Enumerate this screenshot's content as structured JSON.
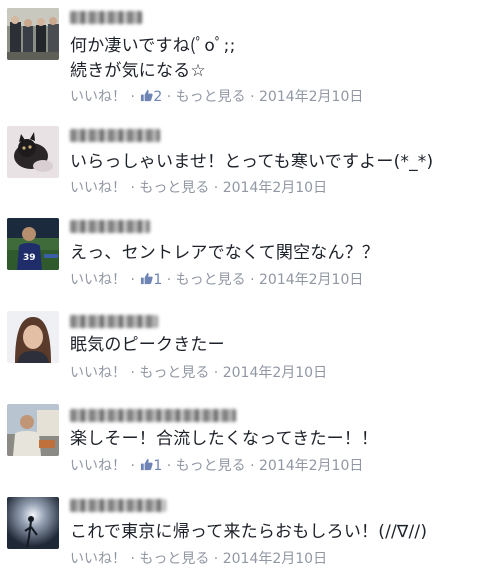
{
  "comments": [
    {
      "text": "何か凄いですね(ﾟoﾟ;;\n続きが気になる☆",
      "actions": {
        "like": "いいね！",
        "like_count": "2",
        "more": "もっと見る",
        "date": "2014年2月10日"
      }
    },
    {
      "text": "いらっしゃいませ！とっても寒いですよー(*_*)",
      "actions": {
        "like": "いいね！",
        "more": "もっと見る",
        "date": "2014年2月10日"
      }
    },
    {
      "text": "えっ、セントレアでなくて関空なん？？",
      "actions": {
        "like": "いいね！",
        "like_count": "1",
        "more": "もっと見る",
        "date": "2014年2月10日"
      }
    },
    {
      "text": "眠気のピークきたー",
      "actions": {
        "like": "いいね！",
        "more": "もっと見る",
        "date": "2014年2月10日"
      }
    },
    {
      "text": "楽しそー！合流したくなってきたー！！",
      "actions": {
        "like": "いいね！",
        "like_count": "1",
        "more": "もっと見る",
        "date": "2014年2月10日"
      }
    },
    {
      "text": "これで東京に帰って来たらおもしろい！(//∇//)",
      "actions": {
        "like": "いいね！",
        "more": "もっと見る",
        "date": "2014年2月10日"
      }
    }
  ],
  "separator": " · ",
  "icons": {
    "like_thumb": "thumbs-up-icon"
  },
  "colors": {
    "text": "#1d2129",
    "meta": "#9197a3",
    "like_count": "#6d84b4"
  }
}
